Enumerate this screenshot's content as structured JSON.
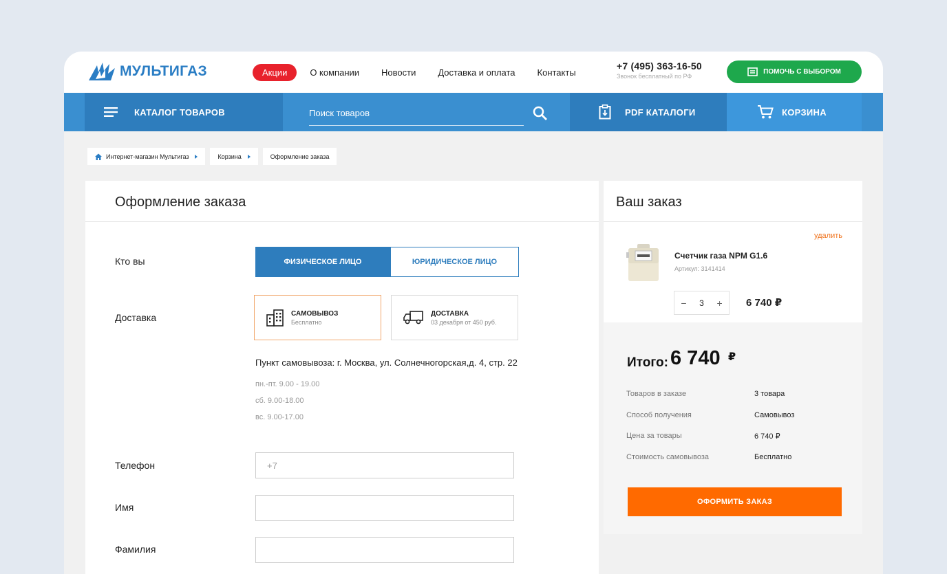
{
  "header": {
    "logo_text": "МУЛЬТИГАЗ",
    "nav": {
      "promo": "Акции",
      "about": "О компании",
      "news": "Новости",
      "delivery": "Доставка и оплата",
      "contacts": "Контакты"
    },
    "phone": "+7 (495) 363-16-50",
    "phone_note": "Звонок бесплатный по РФ",
    "help_button": "ПОМОЧЬ С ВЫБОРОМ"
  },
  "bar": {
    "catalog": "КАТАЛОГ ТОВАРОВ",
    "search_placeholder": "Поиск товаров",
    "pdf": "PDF КАТАЛОГИ",
    "cart": "КОРЗИНА"
  },
  "breadcrumb": [
    "Интернет-магазин Мультигаз",
    "Корзина",
    "Оформление заказа"
  ],
  "checkout": {
    "title": "Оформление заказа",
    "who_label": "Кто вы",
    "person": "ФИЗИЧЕСКОЕ ЛИЦО",
    "company": "ЮРИДИЧЕСКОЕ ЛИЦО",
    "delivery_label": "Доставка",
    "pickup_title": "САМОВЫВОЗ",
    "pickup_sub": "Бесплатно",
    "ship_title": "ДОСТАВКА",
    "ship_sub": "03 декабря от 450 руб.",
    "pickup_address": "Пункт самовывоза: г. Москва, ул. Солнечногорская,д. 4, стр. 22",
    "hours": [
      "пн.-пт. 9.00 - 19.00",
      "сб. 9.00-18.00",
      "вс. 9.00-17.00"
    ],
    "phone_label": "Телефон",
    "phone_value": "+7",
    "name_label": "Имя",
    "surname_label": "Фамилия"
  },
  "order": {
    "title": "Ваш заказ",
    "delete": "удалить",
    "product_name": "Счетчик газа NPM G1.6",
    "product_sku": "Артикул: 3141414",
    "qty_minus": "−",
    "qty": "3",
    "qty_plus": "+",
    "product_price": "6 740 ₽",
    "total_label": "Итого:",
    "total_value": "6 740",
    "total_currency": "₽",
    "rows": [
      {
        "label": "Товаров в заказе",
        "value": "3 товара"
      },
      {
        "label": "Способ получения",
        "value": "Самовывоз"
      },
      {
        "label": "Цена за товары",
        "value": "6 740 ₽"
      },
      {
        "label": "Стоимость самовывоза",
        "value": "Бесплатно"
      }
    ],
    "submit": "ОФОРМИТЬ ЗАКАЗ"
  },
  "colors": {
    "brand_blue": "#2e7dbd",
    "bar_blue": "#3a8fd0",
    "promo_red": "#e8222c",
    "help_green": "#1ea84c",
    "order_orange": "#ff6a00"
  }
}
